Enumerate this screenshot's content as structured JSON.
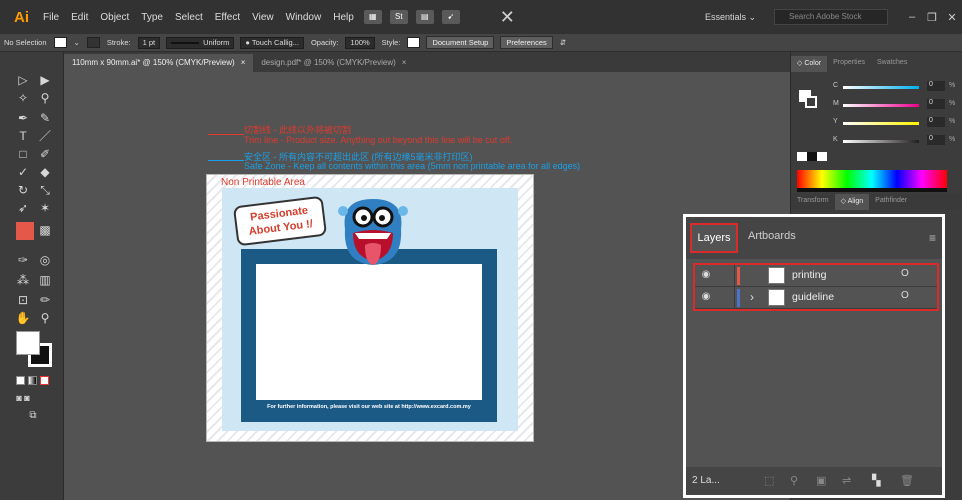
{
  "app": {
    "logo": "Ai",
    "menus": [
      "File",
      "Edit",
      "Object",
      "Type",
      "Select",
      "Effect",
      "View",
      "Window",
      "Help"
    ],
    "workspace": "Essentials ⌄",
    "search_placeholder": "Search Adobe Stock",
    "icon_st": "St"
  },
  "control_bar": {
    "selection": "No Selection",
    "stroke_label": "Stroke:",
    "stroke_value": "1 pt",
    "stroke_profile": "Uniform",
    "brush": "Touch Callig...",
    "opacity_label": "Opacity:",
    "opacity_value": "100%",
    "style_label": "Style:",
    "document_setup": "Document Setup",
    "preferences": "Preferences"
  },
  "tabs": [
    {
      "label": "110mm x 90mm.ai* @ 150% (CMYK/Preview)",
      "active": true
    },
    {
      "label": "design.pdf* @ 150% (CMYK/Preview)",
      "active": false
    }
  ],
  "tab_close": "×",
  "artboard": {
    "non_printable": "Non Printable Area",
    "bubble_line1": "Passionate",
    "bubble_line2": "About You !/",
    "footer": "For further information, please visit our web site at http://www.excard.com.my"
  },
  "guides": {
    "trim_cn": "切割线 - 此线以外将被切割",
    "trim_en": "Trim line - Product size. Anything out beyond this line will be cut off.",
    "safe_cn": "安全区 - 所有内容不可超出此区 (所有边缘5毫米非打印区)",
    "safe_en": "Safe Zone - Keep all contents within this area (5mm non printable area for all edges)"
  },
  "color_panel": {
    "tabs": [
      "◇ Color",
      "Properties",
      "Swatches"
    ],
    "sliders": [
      {
        "label": "C",
        "value": "0",
        "pct": "%",
        "color": "#00aeef"
      },
      {
        "label": "M",
        "value": "0",
        "pct": "%",
        "color": "#ec008c"
      },
      {
        "label": "Y",
        "value": "0",
        "pct": "%",
        "color": "#fff200"
      },
      {
        "label": "K",
        "value": "0",
        "pct": "%",
        "color": "#231f20"
      }
    ]
  },
  "align_tabs": [
    "Transform",
    "◇ Align",
    "Pathfinder"
  ],
  "layers": {
    "tab_layers": "Layers",
    "tab_artboards": "Artboards",
    "menu": "≡",
    "rows": [
      {
        "name": "printing",
        "color": "#e4584a",
        "expand": "",
        "target": "O"
      },
      {
        "name": "guideline",
        "color": "#4b73c9",
        "expand": "›",
        "target": "O"
      }
    ],
    "count": "2 La..."
  },
  "colors": {
    "accent": "#ff9a00",
    "highlight": "#d92b2b",
    "trim_text": "#e03a2e",
    "safe_text": "#1aa0e8"
  }
}
